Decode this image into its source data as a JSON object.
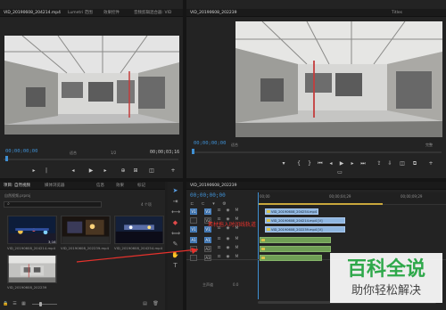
{
  "source_monitor": {
    "tabs": [
      "VID_20190608_204214.mp4",
      "Lumetri 范围",
      "效果控件",
      "音频剪辑混合器: VID"
    ],
    "timecode_left": "00;00;00;00",
    "fit_label": "适合",
    "timecode_right": "00;00;03;16",
    "page_label": "1/2"
  },
  "program_monitor": {
    "tabs": [
      "VID_20190608_202239",
      "",
      "",
      "",
      "",
      "Titles"
    ],
    "timecode_left": "00;00;00;00",
    "fit_label": "适合",
    "page_label": "完整"
  },
  "project": {
    "tabs": [
      "项目: 自然视频",
      "媒体浏览器",
      "信息",
      "效果",
      "标记"
    ],
    "path": "自然视频.prproj",
    "count_label": "4 个项",
    "items": [
      {
        "label": "VID_20190608_204214.mp4",
        "duration": "3;16",
        "scene": "night"
      },
      {
        "label": "VID_20190608_202239.mp4",
        "duration": "",
        "scene": "street"
      },
      {
        "label": "VID_20190608_204254.mp4",
        "duration": "",
        "scene": "night2"
      },
      {
        "label": "VID_20190608_202239",
        "duration": "",
        "scene": "hall"
      }
    ]
  },
  "timeline": {
    "tab": "VID_20190608_202239",
    "timecode": "00;00;00;00",
    "ruler": [
      "00;00",
      "00;00;04;29",
      "00;00;09;29"
    ],
    "annotation": "素材拖入时间线轨道",
    "tracks": [
      {
        "name": "V3",
        "target": "V1",
        "enabled": true
      },
      {
        "name": "V2",
        "target": "",
        "enabled": false
      },
      {
        "name": "V1",
        "target": "V1",
        "enabled": true
      },
      {
        "name": "A1",
        "target": "A1",
        "enabled": true
      },
      {
        "name": "A2",
        "target": "",
        "enabled": false
      },
      {
        "name": "A3",
        "target": "",
        "enabled": false
      }
    ],
    "master_label": "主声道",
    "master_value": "0.0",
    "clips": [
      {
        "label": "VID_20190608_204254.mp4 [V]",
        "kind": "v"
      },
      {
        "label": "VID_20190608_204214.mp4 [V]",
        "kind": "v"
      },
      {
        "label": "VID_20190608_202239.mp4 [V]",
        "kind": "v"
      },
      {
        "label": "",
        "kind": "a"
      },
      {
        "label": "",
        "kind": "a"
      },
      {
        "label": "",
        "kind": "a"
      }
    ]
  },
  "watermark": {
    "title": "百科全说",
    "subtitle": "助你轻松解决"
  },
  "colors": {
    "accent": "#3f8fd2",
    "annotation": "#e6322c",
    "watermark": "#2ea84a"
  }
}
